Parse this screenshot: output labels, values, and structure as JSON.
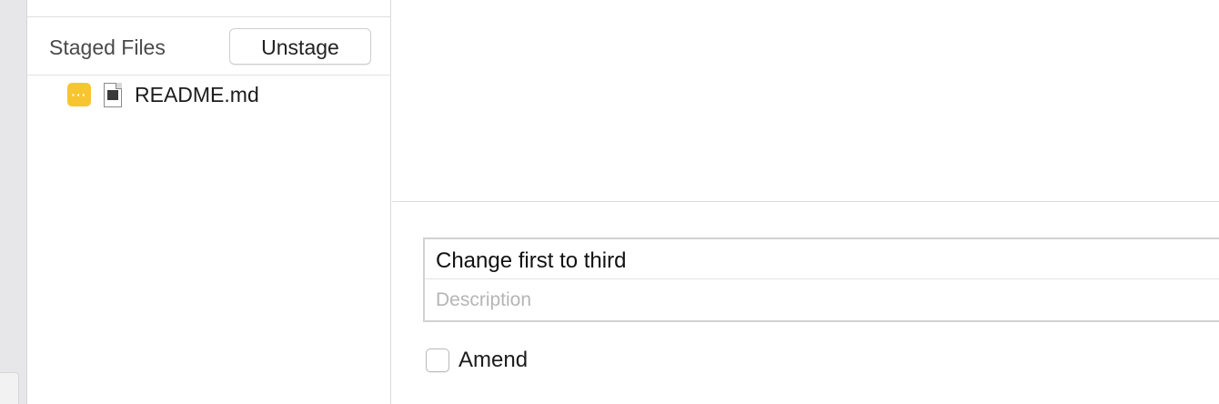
{
  "sidebar": {
    "staged_title": "Staged Files",
    "unstage_label": "Unstage",
    "files": [
      {
        "name": "README.md",
        "status_glyph": "···",
        "status_color": "#f6c530",
        "icon": "document-icon"
      }
    ]
  },
  "commit": {
    "summary": "Change first to third",
    "description_placeholder": "Description",
    "amend_label": "Amend",
    "amend_checked": false
  }
}
